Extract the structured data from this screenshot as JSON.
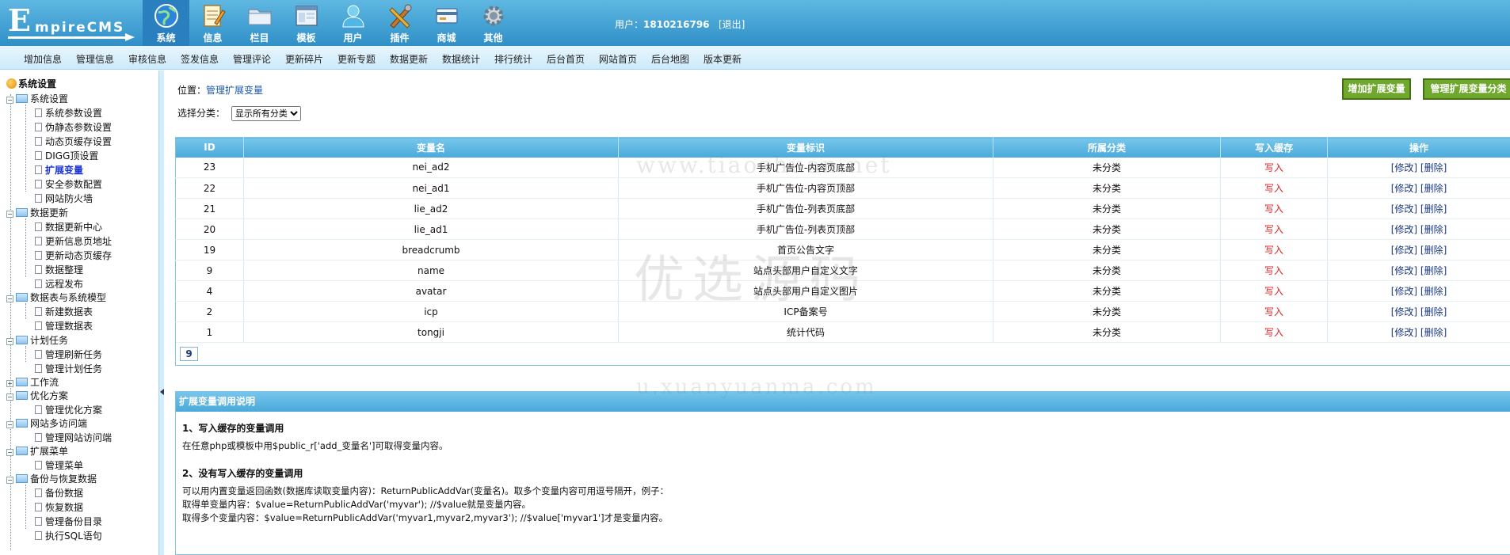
{
  "header": {
    "logo_initial": "E",
    "logo_rest": "mpireCMS",
    "tabs": [
      {
        "label": "系统",
        "icon": "globe-icon"
      },
      {
        "label": "信息",
        "icon": "notepad-icon"
      },
      {
        "label": "栏目",
        "icon": "folder-icon"
      },
      {
        "label": "模板",
        "icon": "window-template-icon"
      },
      {
        "label": "用户",
        "icon": "user-icon"
      },
      {
        "label": "插件",
        "icon": "tools-icon"
      },
      {
        "label": "商城",
        "icon": "card-icon"
      },
      {
        "label": "其他",
        "icon": "gear-icon"
      }
    ],
    "user_prefix": "用户：",
    "user_name": "1810216796",
    "logout": "[退出]"
  },
  "submenu": [
    "增加信息",
    "管理信息",
    "审核信息",
    "签发信息",
    "管理评论",
    "更新碎片",
    "更新专题",
    "数据更新",
    "数据统计",
    "排行统计",
    "后台首页",
    "网站首页",
    "后台地图",
    "版本更新"
  ],
  "tree": {
    "root": "系统设置",
    "groups": [
      {
        "label": "系统设置",
        "expanded": true,
        "items": [
          "系统参数设置",
          "伪静态参数设置",
          "动态页缓存设置",
          "DIGG顶设置",
          "扩展变量",
          "安全参数配置",
          "网站防火墙"
        ]
      },
      {
        "label": "数据更新",
        "expanded": true,
        "items": [
          "数据更新中心",
          "更新信息页地址",
          "更新动态页缓存",
          "数据整理",
          "远程发布"
        ]
      },
      {
        "label": "数据表与系统模型",
        "expanded": true,
        "items": [
          "新建数据表",
          "管理数据表"
        ]
      },
      {
        "label": "计划任务",
        "expanded": true,
        "items": [
          "管理刷新任务",
          "管理计划任务"
        ]
      },
      {
        "label": "工作流",
        "expanded": false,
        "items": []
      },
      {
        "label": "优化方案",
        "expanded": true,
        "items": [
          "管理优化方案"
        ]
      },
      {
        "label": "网站多访问端",
        "expanded": true,
        "items": [
          "管理网站访问端"
        ]
      },
      {
        "label": "扩展菜单",
        "expanded": true,
        "items": [
          "管理菜单"
        ]
      },
      {
        "label": "备份与恢复数据",
        "expanded": true,
        "items": [
          "备份数据",
          "恢复数据",
          "管理备份目录",
          "执行SQL语句"
        ]
      }
    ],
    "current_item": "扩展变量"
  },
  "page": {
    "location_prefix": "位置：",
    "location_link": "管理扩展变量",
    "category_label": "选择分类：",
    "category_selected": "显示所有分类",
    "btn_add": "增加扩展变量",
    "btn_manage_cat": "管理扩展变量分类"
  },
  "table": {
    "columns": [
      "ID",
      "变量名",
      "变量标识",
      "所属分类",
      "写入缓存",
      "操作"
    ],
    "rows": [
      {
        "id": "23",
        "name": "nei_ad2",
        "ident": "手机广告位-内容页底部",
        "cat": "未分类",
        "cache": "写入"
      },
      {
        "id": "22",
        "name": "nei_ad1",
        "ident": "手机广告位-内容页顶部",
        "cat": "未分类",
        "cache": "写入"
      },
      {
        "id": "21",
        "name": "lie_ad2",
        "ident": "手机广告位-列表页底部",
        "cat": "未分类",
        "cache": "写入"
      },
      {
        "id": "20",
        "name": "lie_ad1",
        "ident": "手机广告位-列表页顶部",
        "cat": "未分类",
        "cache": "写入"
      },
      {
        "id": "19",
        "name": "breadcrumb",
        "ident": "首页公告文字",
        "cat": "未分类",
        "cache": "写入"
      },
      {
        "id": "9",
        "name": "name",
        "ident": "站点头部用户自定义文字",
        "cat": "未分类",
        "cache": "写入"
      },
      {
        "id": "4",
        "name": "avatar",
        "ident": "站点头部用户自定义图片",
        "cat": "未分类",
        "cache": "写入"
      },
      {
        "id": "2",
        "name": "icp",
        "ident": "ICP备案号",
        "cat": "未分类",
        "cache": "写入"
      },
      {
        "id": "1",
        "name": "tongji",
        "ident": "统计代码",
        "cat": "未分类",
        "cache": "写入"
      }
    ],
    "op_edit": "[修改]",
    "op_delete": "[删除]",
    "pager": "9"
  },
  "explain": {
    "title": "扩展变量调用说明",
    "s1_title": "1、写入缓存的变量调用",
    "s1_text": "在任意php或模板中用$public_r['add_变量名']可取得变量内容。",
    "s2_title": "2、没有写入缓存的变量调用",
    "s2_line1": "可以用内置变量返回函数(数据库读取变量内容)：ReturnPublicAddVar(变量名)。取多个变量内容可用逗号隔开，例子：",
    "s2_line2": "取得单变量内容：$value=ReturnPublicAddVar('myvar'); //$value就是变量内容。",
    "s2_line3": "取得多个变量内容：$value=ReturnPublicAddVar('myvar1,myvar2,myvar3'); //$value['myvar1']才是变量内容。"
  },
  "watermarks": [
    "www.tiaozhuan.net",
    "优选源码",
    "u.xuanyuanma.com"
  ]
}
